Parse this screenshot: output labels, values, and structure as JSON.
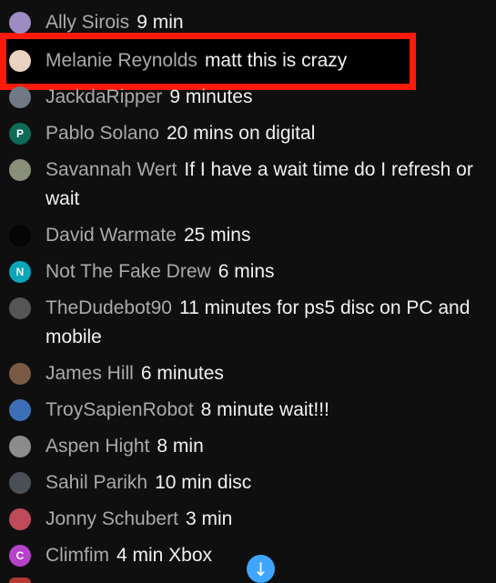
{
  "messages": [
    {
      "author": "Ally Sirois",
      "text": "9 min",
      "avatar": {
        "icon": "avatar-photo",
        "color": "#9d8bc4"
      }
    },
    {
      "author": "Melanie Reynolds",
      "text": "matt this is crazy",
      "avatar": {
        "icon": "avatar-photo",
        "color": "#e9d4c2"
      }
    },
    {
      "author": "JackdaRipper",
      "text": "9 minutes",
      "avatar": {
        "icon": "avatar-photo",
        "color": "#6f7a86"
      }
    },
    {
      "author": "Pablo Solano",
      "text": "20 mins on digital",
      "avatar": {
        "letter": "P",
        "color": "#0e6b57"
      }
    },
    {
      "author": "Savannah Wert",
      "text": "If I have a wait time do I refresh or wait",
      "avatar": {
        "icon": "avatar-photo",
        "color": "#8a8f7a"
      }
    },
    {
      "author": "David Warmate",
      "text": "25 mins",
      "avatar": {
        "icon": "avatar-photo",
        "color": "#050505"
      }
    },
    {
      "author": "Not The Fake Drew",
      "text": "6 mins",
      "avatar": {
        "letter": "N",
        "color": "#0aa5b8"
      }
    },
    {
      "author": "TheDudebot90",
      "text": "11 minutes for ps5 disc on PC and mobile",
      "avatar": {
        "icon": "avatar-photo",
        "color": "#555555"
      }
    },
    {
      "author": "James Hill",
      "text": "6 minutes",
      "avatar": {
        "icon": "avatar-photo",
        "color": "#7a5a45"
      }
    },
    {
      "author": "TroySapienRobot",
      "text": "8 minute wait!!!",
      "avatar": {
        "icon": "avatar-photo",
        "color": "#3d6fb8"
      }
    },
    {
      "author": "Aspen Hight",
      "text": "8 min",
      "avatar": {
        "icon": "avatar-photo",
        "color": "#8c8c8c"
      }
    },
    {
      "author": "Sahil Parikh",
      "text": "10 min disc",
      "avatar": {
        "icon": "avatar-photo",
        "color": "#4a4f55"
      }
    },
    {
      "author": "Jonny Schubert",
      "text": "3 min",
      "avatar": {
        "icon": "avatar-photo",
        "color": "#c04a5a"
      }
    },
    {
      "author": "Climfim",
      "text": "4 min Xbox",
      "avatar": {
        "letter": "C",
        "color": "#b542c9"
      }
    }
  ],
  "highlight_color": "#ff1a0a",
  "scroll_button": {
    "icon": "arrow-down-icon",
    "glyph": "↓",
    "color": "#3ea6ff"
  }
}
